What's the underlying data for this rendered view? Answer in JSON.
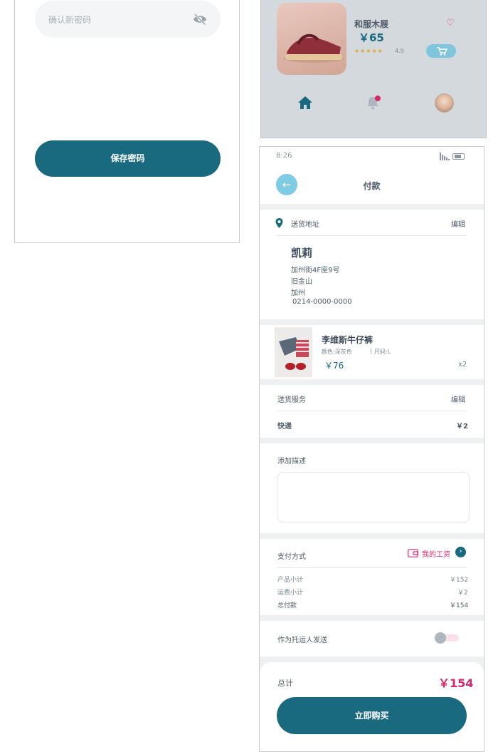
{
  "password_screen": {
    "confirm_placeholder": "确认新密码",
    "save_label": "保存密码"
  },
  "product_card": {
    "name": "和服木屐",
    "price": "￥65",
    "stars": "★★★★★",
    "rating": "4.9"
  },
  "payment": {
    "status_time": "8:26",
    "title": "付款",
    "address": {
      "label": "送货地址",
      "edit": "编辑",
      "name": "凯莉",
      "lines": [
        "加州街4F座9号",
        "旧金山",
        "加州",
        "0214-0000-0000"
      ]
    },
    "item": {
      "name": "李维斯牛仔裤",
      "color": "颜色:深灰色",
      "size": "尺码:L",
      "price": "￥76",
      "qty": "x2"
    },
    "delivery": {
      "label": "送货服务",
      "edit": "编辑",
      "method": "快递",
      "cost": "￥2"
    },
    "note": {
      "label": "添加描述",
      "placeholder": ""
    },
    "payment_method": {
      "label": "支付方式",
      "wallet": "我的工资"
    },
    "summary": {
      "subtotal_label": "产品小计",
      "subtotal": "￥152",
      "shipping_label": "运费小计",
      "shipping": "￥2",
      "total_label": "总付款",
      "total": "￥154"
    },
    "consignor": {
      "label": "作为托运人发送",
      "enabled": false
    },
    "footer": {
      "total_label": "总计",
      "total": "￥154",
      "buy_label": "立即购买"
    }
  },
  "colors": {
    "primary": "#1a6a7f",
    "accent": "#d9276d",
    "light_blue": "#7fcbe4",
    "star": "#e2a531"
  }
}
